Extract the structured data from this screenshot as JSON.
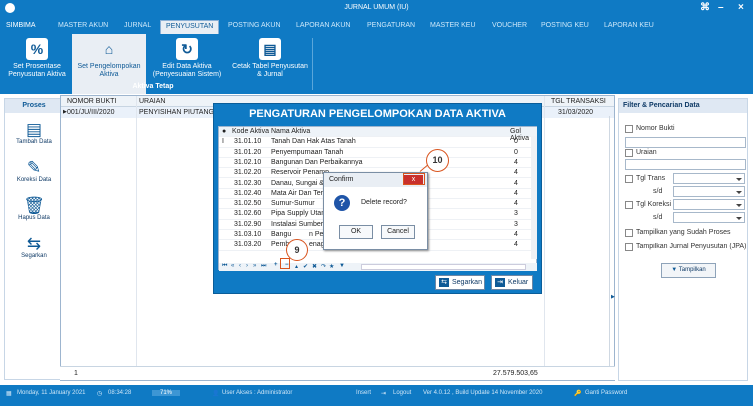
{
  "window": {
    "app_name": "SIMBIMA",
    "title": "JURNAL UMUM (IU)"
  },
  "menu": [
    "MASTER AKUN",
    "JURNAL",
    "PENYUSUTAN",
    "POSTING AKUN",
    "LAPORAN AKUN",
    "PENGATURAN",
    "MASTER KEU",
    "VOUCHER",
    "POSTING KEU",
    "LAPORAN KEU"
  ],
  "ribbon": {
    "buttons": [
      {
        "label": "Set Prosentase Penyusutan Aktiva",
        "icon": "percent-icon"
      },
      {
        "label": "Set Pengelompokan Aktiva",
        "icon": "house-icon"
      },
      {
        "label": "Edit Data Aktiva (Penyesuaian Sistem)",
        "icon": "refresh-icon"
      },
      {
        "label": "Cetak Tabel Penyusutan & Jurnal",
        "icon": "print-icon"
      }
    ],
    "group_label": "Aktiva Tetap"
  },
  "left_panel": {
    "title": "Proses",
    "buttons": [
      "Tambah Data",
      "Koreksi Data",
      "Hapus Data",
      "Segarkan"
    ]
  },
  "grid": {
    "headers": [
      "NOMOR BUKTI",
      "URAIAN",
      "TGL TRANSAKSI"
    ],
    "row": {
      "nomor": "001/JU/III/2020",
      "uraian": "PENYISIHAN PIUTANG E",
      "tanggal": "31/03/2020"
    },
    "footer_count": "1",
    "footer_total": "27.579.503,65"
  },
  "right_panel": {
    "title": "Filter & Pencarian Data",
    "nomor_bukti": "Nomor Bukti",
    "uraian": "Uraian",
    "tgl_trans": "Tgl Trans",
    "sd1": "s/d",
    "tgl_koreksi": "Tgl Koreksi",
    "sd2": "s/d",
    "proses_label": "Tampilkan yang Sudah Proses",
    "jurnal_label": "Tampilkan Jurnal Penyusutan (JPA)",
    "button": "Tampilkan"
  },
  "dialog": {
    "title": "PENGATURAN PENGELOMPOKAN DATA AKTIVA",
    "columns": [
      "Kode Aktiva",
      "Nama Aktiva",
      "Gol Aktiva"
    ],
    "rows": [
      {
        "kode": "31.01.10",
        "nama": "Tanah Dan Hak Atas Tanah",
        "gol": "0"
      },
      {
        "kode": "31.01.20",
        "nama": "Penyempurnaan Tanah",
        "gol": "0"
      },
      {
        "kode": "31.02.10",
        "nama": "Bangunan Dan Perbaikannya",
        "gol": "4"
      },
      {
        "kode": "31.02.20",
        "nama": "Reservoir Penamp",
        "gol": "4"
      },
      {
        "kode": "31.02.30",
        "nama": "Danau, Sungai & S",
        "gol": "4"
      },
      {
        "kode": "31.02.40",
        "nama": "Mata Air Dan Terov",
        "gol": "4"
      },
      {
        "kode": "31.02.50",
        "nama": "Sumur-Sumur",
        "gol": "4"
      },
      {
        "kode": "31.02.60",
        "nama": "Pipa Supply Utam",
        "gol": "3"
      },
      {
        "kode": "31.02.90",
        "nama": "Instalasi Sumber I",
        "gol": "3"
      },
      {
        "kode": "31.03.10",
        "nama": "Bangu",
        "gol": "4"
      },
      {
        "kode": "31.03.20",
        "nama": "Pemba",
        "gol": "4"
      }
    ],
    "row11_tail": "n Pe",
    "row12_tail": "enaga Listrik",
    "btn_segarkan": "Segarkan",
    "btn_keluar": "Keluar"
  },
  "confirm": {
    "title": "Confirm",
    "message": "Delete record?",
    "ok": "OK",
    "cancel": "Cancel",
    "close": "x"
  },
  "callouts": {
    "step9": "9",
    "step10": "10"
  },
  "footer": {
    "date": "Monday, 11 January 2021",
    "time": "08:34:28",
    "percent": "71%",
    "user": "User Akses : Administrator",
    "insert": "Insert",
    "logout": "Logout",
    "version": "Ver 4.0.12 , Build Update 14 November 2020",
    "password": "Ganti Password"
  }
}
